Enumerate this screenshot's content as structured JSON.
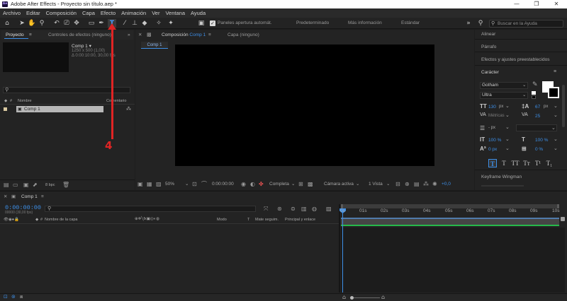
{
  "window": {
    "title": "Adobe After Effects - Proyecto sin título.aep *",
    "app_icon": "Ae",
    "controls": [
      "—",
      "❐",
      "✕"
    ]
  },
  "menubar": [
    "Archivo",
    "Editar",
    "Composición",
    "Capa",
    "Efecto",
    "Animación",
    "Ver",
    "Ventana",
    "Ayuda"
  ],
  "toolbar": {
    "panel_option": "Paneles apertura automát.",
    "workspaces": [
      "Predeterminado",
      "Más información",
      "Estándar"
    ],
    "search_placeholder": "Buscar en la Ayuda"
  },
  "project_panel": {
    "tab_project": "Proyecto",
    "tab_effects": "Controles de efectos (ninguno)",
    "comp_name": "Comp 1 ▾",
    "comp_size": "1250 x 500 (1,00)",
    "comp_duration": "Δ 0:00:10:00, 30,00 fps",
    "col_name": "Nombre",
    "col_comment": "Comentario",
    "item": "Comp 1",
    "bpc": "8 bpc"
  },
  "composition_panel": {
    "tab_comp_prefix": "Composición",
    "tab_comp_name": "Comp 1",
    "tab_layer": "Capa  (ninguno)",
    "breadcrumb": "Comp 1",
    "zoom": "50%",
    "timecode": "0:00:00:00",
    "resolution": "Completa",
    "camera": "Cámara activa",
    "views": "1 Vista",
    "exposure": "+0,0"
  },
  "right_panels": {
    "align": "Alinear",
    "paragraph": "Párrafo",
    "effects_presets": "Efectos y ajustes preestablecidos",
    "character": "Carácter",
    "font_family": "Gotham",
    "font_style": "Ultra",
    "font_size": "130",
    "font_size_unit": "px",
    "leading": "67",
    "leading_unit": "px",
    "kerning": "Métricas",
    "tracking": "25",
    "stroke_unit": "px",
    "vscale": "100 %",
    "hscale": "100 %",
    "baseline": "0 px",
    "tsume": "0 %",
    "keyframe_wingman": "Keyframe Wingman",
    "fill_color": "#ffffff",
    "stroke_color": "#000000"
  },
  "timeline": {
    "tab": "Comp 1",
    "timecode": "0:00:00:00",
    "fps_info": "00000 (30,00 fps)",
    "col_layer_name": "Nombre de la capa",
    "col_mode": "Modo",
    "col_t": "T",
    "col_track_matte": "Mate seguim.",
    "col_parent": "Principal y enlace",
    "ruler": [
      "0s",
      "01s",
      "02s",
      "03s",
      "04s",
      "05s",
      "06s",
      "07s",
      "08s",
      "09s",
      "10s"
    ]
  },
  "annotation": {
    "step": "4",
    "color": "#e02424"
  }
}
